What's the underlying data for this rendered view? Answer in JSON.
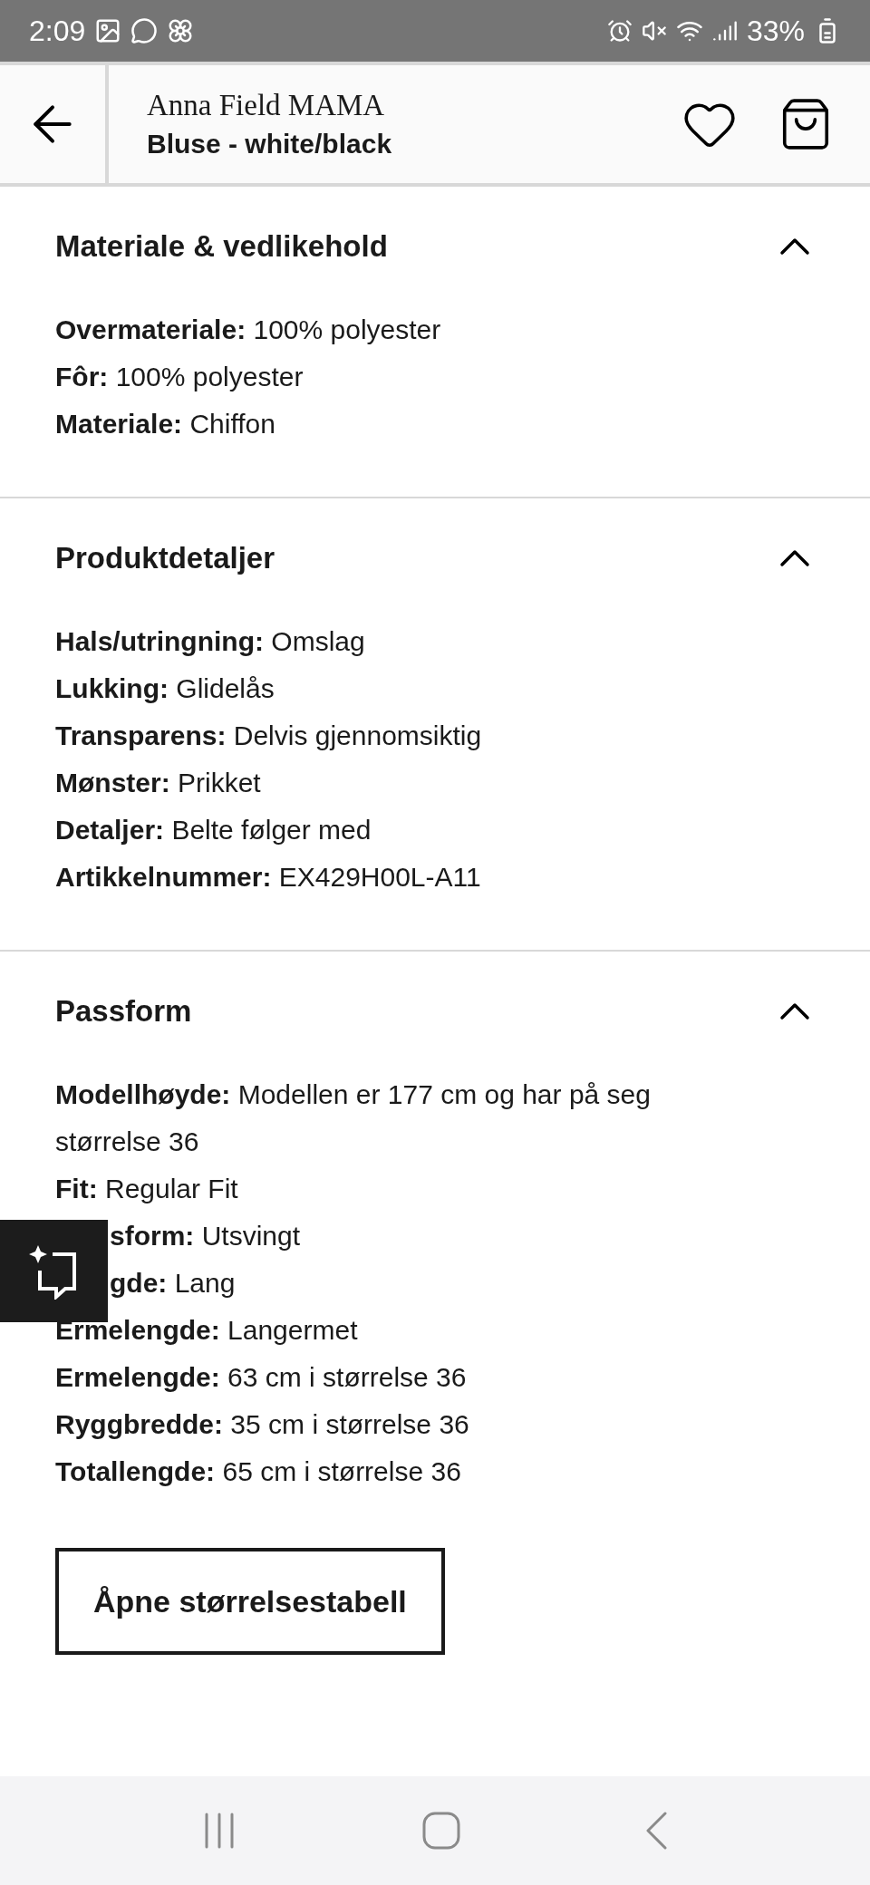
{
  "status_bar": {
    "time": "2:09",
    "battery": "33%"
  },
  "header": {
    "brand": "Anna Field MAMA",
    "product": "Bluse - white/black"
  },
  "sections": [
    {
      "title": "Materiale & vedlikehold",
      "expanded": true,
      "rows": [
        {
          "text": "**Overmateriale:** 100% polyester",
          "kind": "plain"
        },
        {
          "text": "**Fôr:** 100% polyester",
          "kind": "plain"
        },
        {
          "text": "**Materiale:** Chiffon",
          "kind": "plain"
        }
      ]
    },
    {
      "title": "Produktdetaljer",
      "expanded": true,
      "rows": [
        {
          "text": "**Hals/utringning:** Omslag",
          "kind": "plain"
        },
        {
          "text": "**Lukking:** Glidelås",
          "kind": "plain"
        },
        {
          "text": "**Transparens:** Delvis gjennomsiktig",
          "kind": "plain"
        },
        {
          "text": "**Mønster:** Prikket",
          "kind": "plain"
        },
        {
          "text": "**Detaljer:** Belte følger med",
          "kind": "plain"
        },
        {
          "text": "**Artikkelnummer:** EX429H00L-A11",
          "kind": "plain"
        }
      ]
    },
    {
      "title": "Passform",
      "expanded": true,
      "rows": [
        {
          "text": "**Modellhøyde:** Modellen er 177 cm og har på seg størrelse 36",
          "kind": "plain"
        },
        {
          "text": "**Fit:** Regular Fit",
          "kind": "plain"
        },
        {
          "text": "**sform:** Utsvingt",
          "kind": "partly_hidden"
        },
        {
          "text": "**gde:** Lang",
          "kind": "partly_hidden"
        },
        {
          "text": "**Ermelengde:** Langermet",
          "kind": "plain"
        },
        {
          "text": "**Ermelengde:** 63 cm i størrelse 36",
          "kind": "plain"
        },
        {
          "text": "**Ryggbredde:** 35 cm i størrelse 36",
          "kind": "plain"
        },
        {
          "text": "**Totallengde:** 65 cm i størrelse 36",
          "kind": "plain"
        }
      ]
    }
  ],
  "size_table_button": "Åpne størrelsestabell"
}
